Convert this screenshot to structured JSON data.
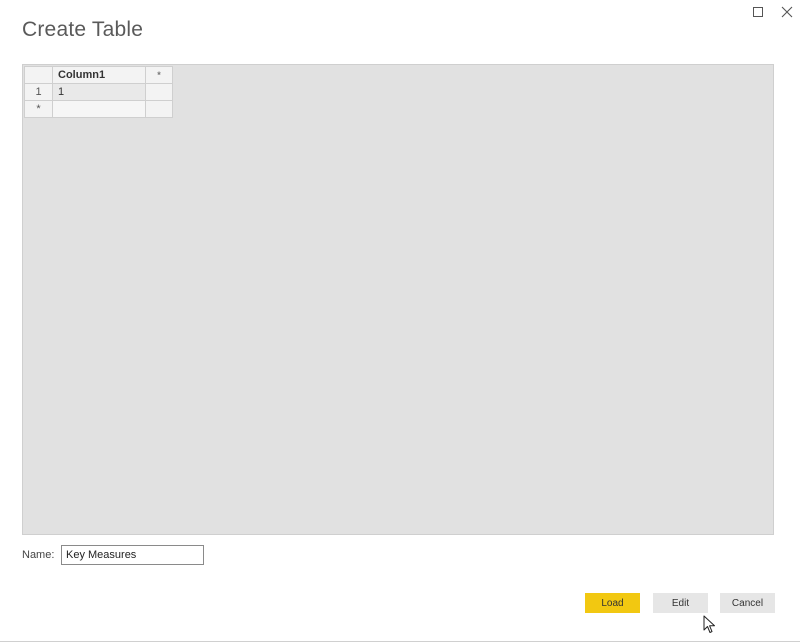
{
  "dialog": {
    "title": "Create Table"
  },
  "window_controls": {
    "maximize_icon": "maximize-icon",
    "close_icon": "close-icon"
  },
  "grid": {
    "columns": [
      "Column1"
    ],
    "add_column_marker": "*",
    "rows": [
      {
        "row_number": "1",
        "cells": [
          "1"
        ]
      }
    ],
    "new_row_marker": "*"
  },
  "name_field": {
    "label": "Name:",
    "value": "Key Measures"
  },
  "buttons": {
    "load": "Load",
    "edit": "Edit",
    "cancel": "Cancel"
  },
  "colors": {
    "primary_button": "#f2c811",
    "secondary_button": "#e6e6e6",
    "grid_background": "#e1e1e1"
  }
}
